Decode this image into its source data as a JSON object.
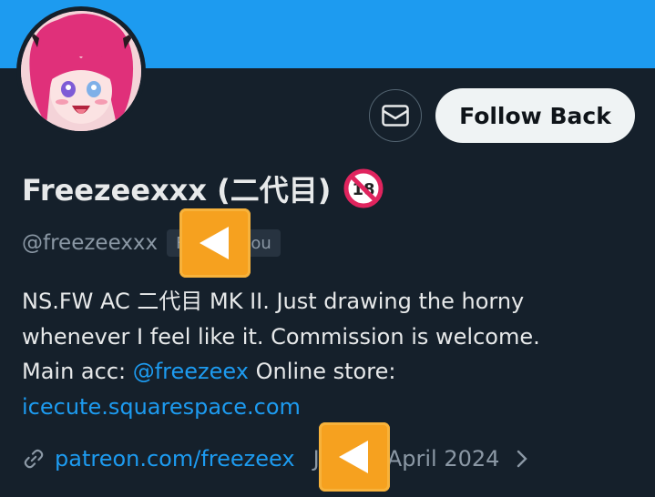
{
  "profile": {
    "display_name": "Freezeexxx (二代目)",
    "adult_badge": "🔞",
    "handle": "@freezeexxx",
    "follows_you": "Follows you",
    "bio_part1": "NS.FW AC 二代目 MK II. Just drawing the horny whenever I feel like it. Commission is welcome. Main acc: ",
    "bio_mention": "@freezeex",
    "bio_part2": " Online store: ",
    "bio_link": "icecute.squarespace.com",
    "website": "patreon.com/freezeex",
    "joined": "Joined April 2024"
  },
  "actions": {
    "follow_label": "Follow Back",
    "message_icon": "envelope-icon"
  },
  "overlay": {
    "arrow_icon": "left-arrow-button-icon"
  },
  "colors": {
    "banner": "#1d9bf0",
    "background": "#15202b",
    "link": "#1d9bf0",
    "muted": "#8b98a5",
    "follow_bg": "#eff3f4",
    "arrow_bg": "#f6a11f"
  }
}
